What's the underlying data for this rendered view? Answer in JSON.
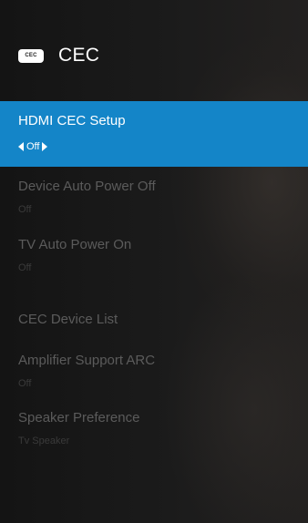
{
  "header": {
    "icon_text": "CEC",
    "title": "CEC"
  },
  "menu": {
    "items": [
      {
        "label": "HDMI CEC Setup",
        "value": "Off"
      },
      {
        "label": "Device Auto Power Off",
        "value": "Off"
      },
      {
        "label": "TV Auto Power On",
        "value": "Off"
      },
      {
        "label": "CEC Device List"
      },
      {
        "label": "Amplifier Support ARC",
        "value": "Off"
      },
      {
        "label": "Speaker Preference",
        "value": "Tv Speaker"
      }
    ]
  },
  "colors": {
    "selection": "#1485c8",
    "background": "#161616",
    "disabled_text": "#5b5b5b"
  }
}
